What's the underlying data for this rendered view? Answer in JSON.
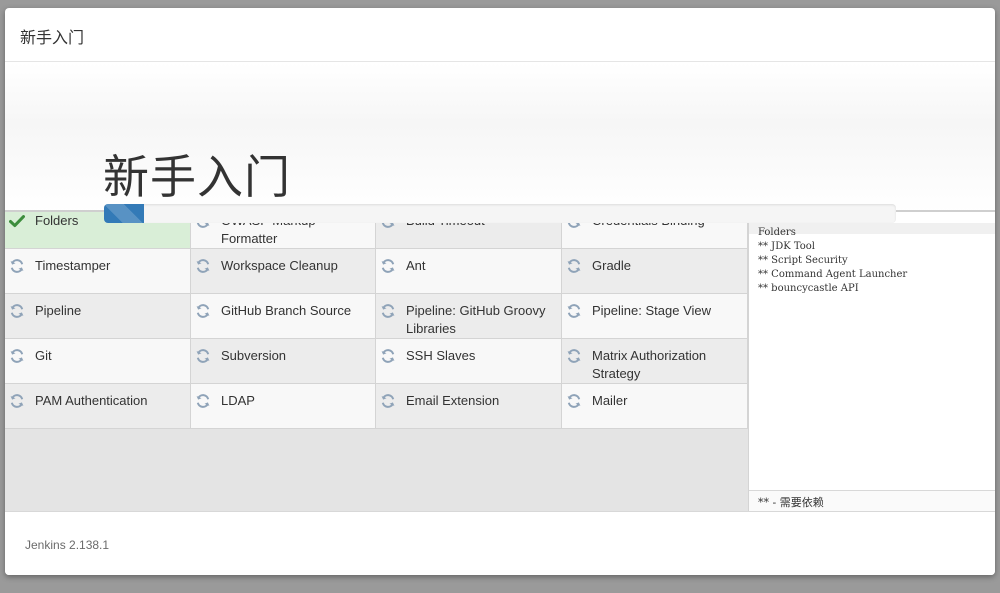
{
  "dialog": {
    "header_title": "新手入门",
    "hero_title": "新手入门",
    "progress_percent": 5
  },
  "plugins": [
    {
      "name": "Folders",
      "status": "done"
    },
    {
      "name": "OWASP Markup Formatter",
      "status": "pending"
    },
    {
      "name": "Build Timeout",
      "status": "pending"
    },
    {
      "name": "Credentials Binding",
      "status": "pending"
    },
    {
      "name": "Timestamper",
      "status": "pending"
    },
    {
      "name": "Workspace Cleanup",
      "status": "pending"
    },
    {
      "name": "Ant",
      "status": "pending"
    },
    {
      "name": "Gradle",
      "status": "pending"
    },
    {
      "name": "Pipeline",
      "status": "pending"
    },
    {
      "name": "GitHub Branch Source",
      "status": "pending"
    },
    {
      "name": "Pipeline: GitHub Groovy Libraries",
      "status": "pending"
    },
    {
      "name": "Pipeline: Stage View",
      "status": "pending"
    },
    {
      "name": "Git",
      "status": "pending"
    },
    {
      "name": "Subversion",
      "status": "pending"
    },
    {
      "name": "SSH Slaves",
      "status": "pending"
    },
    {
      "name": "Matrix Authorization Strategy",
      "status": "pending"
    },
    {
      "name": "PAM Authentication",
      "status": "pending"
    },
    {
      "name": "LDAP",
      "status": "pending"
    },
    {
      "name": "Email Extension",
      "status": "pending"
    },
    {
      "name": "Mailer",
      "status": "pending"
    }
  ],
  "install_log": {
    "lines": [
      "Folders",
      "** JDK Tool",
      "** Script Security",
      "** Command Agent Launcher",
      "** bouncycastle API"
    ],
    "legend": "** - 需要依赖"
  },
  "footer": {
    "version": "Jenkins 2.138.1"
  },
  "icons": {
    "done": "check-icon",
    "pending": "refresh-icon"
  },
  "colors": {
    "progress": "#337ab7",
    "done_bg": "#d9eed7",
    "check": "#3c8d3c",
    "refresh": "#8fa3b8"
  }
}
